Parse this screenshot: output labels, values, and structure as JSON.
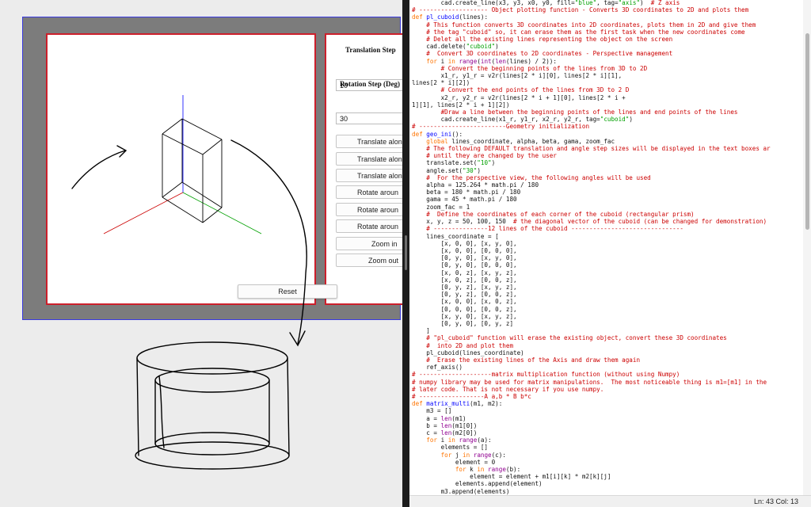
{
  "app": {
    "controls": {
      "translation_step_label": "Translation Step",
      "translation_step_value": "10",
      "rotation_step_label": "Rotation Step (Deg)",
      "rotation_step_value": "30",
      "buttons": [
        "Translate alon",
        "Translate alon",
        "Translate alon",
        "Rotate aroun",
        "Rotate aroun",
        "Rotate aroun",
        "Zoom in",
        "Zoom out"
      ]
    },
    "reset_label": "Reset"
  },
  "colors": {
    "axis_x": "#cc0000",
    "axis_y": "#00a000",
    "axis_z": "#0000ff",
    "frame_border": "#cc1f2b",
    "window_border": "#3a3adf"
  },
  "editor": {
    "status": "Ln: 43  Col: 13",
    "lines": [
      [
        [
          "n",
          "        cad.create_line(x3, y3, x0, y0, fill="
        ],
        [
          "st",
          "\"blue\""
        ],
        [
          "n",
          ", tag="
        ],
        [
          "st",
          "\"axis\""
        ],
        [
          "n",
          ")  "
        ],
        [
          "cm",
          "# Z axis"
        ]
      ],
      [
        [
          "cm",
          "# ------------------- Object plotting function - Converts 3D coordinates to 2D and plots them"
        ]
      ],
      [
        [
          "kw",
          "def "
        ],
        [
          "df",
          "pl_cuboid"
        ],
        [
          "n",
          "(lines):"
        ]
      ],
      [
        [
          "cm",
          "    # This function converts 3D coordinates into 2D coordinates, plots them in 2D and give them"
        ]
      ],
      [
        [
          "cm",
          "    # the tag \"cuboid\" so, it can erase them as the first task when the new coordinates come"
        ]
      ],
      [
        [
          "cm",
          "    # Delet all the existing lines representing the object on the screen"
        ]
      ],
      [
        [
          "n",
          "    cad.delete("
        ],
        [
          "st",
          "\"cuboid\""
        ],
        [
          "n",
          ")"
        ]
      ],
      [
        [
          "cm",
          "    #  Convert 3D coordinates to 2D coordinates - Perspective management"
        ]
      ],
      [
        [
          "kw",
          "    for "
        ],
        [
          "n",
          "i "
        ],
        [
          "kw",
          "in "
        ],
        [
          "bi",
          "range"
        ],
        [
          "n",
          "("
        ],
        [
          "bi",
          "int"
        ],
        [
          "n",
          "("
        ],
        [
          "bi",
          "len"
        ],
        [
          "n",
          "(lines) / 2)):"
        ]
      ],
      [
        [
          "cm",
          "        # Convert the beginning points of the lines from 3D to 2D"
        ]
      ],
      [
        [
          "n",
          "        x1_r, y1_r = v2r(lines[2 * i][0], lines[2 * i][1],"
        ]
      ],
      [
        [
          "n",
          "lines[2 * i][2])"
        ]
      ],
      [
        [
          "cm",
          "        # Convert the end points of the lines from 3D to 2 D"
        ]
      ],
      [
        [
          "n",
          "        x2_r, y2_r = v2r(lines[2 * i + 1][0], lines[2 * i +"
        ]
      ],
      [
        [
          "n",
          "1][1], lines[2 * i + 1][2])"
        ]
      ],
      [
        [
          "cm",
          "        #Draw a line between the beginning points of the lines and end points of the lines"
        ]
      ],
      [
        [
          "n",
          "        cad.create_line(x1_r, y1_r, x2_r, y2_r, tag="
        ],
        [
          "st",
          "\"cuboid\""
        ],
        [
          "n",
          ")"
        ]
      ],
      [
        [
          "cm",
          "# ------------------------Geometry initialization"
        ]
      ],
      [
        [
          "kw",
          "def "
        ],
        [
          "df",
          "geo_ini"
        ],
        [
          "n",
          "():"
        ]
      ],
      [
        [
          "kw",
          "    global "
        ],
        [
          "n",
          "lines_coordinate, alpha, beta, gama, zoom_fac"
        ]
      ],
      [
        [
          "cm",
          "    # The following DEFAULT translation and angle step sizes will be displayed in the text boxes ar"
        ]
      ],
      [
        [
          "cm",
          "    # until they are changed by the user"
        ]
      ],
      [
        [
          "n",
          "    translate.set("
        ],
        [
          "st",
          "\"10\""
        ],
        [
          "n",
          ")"
        ]
      ],
      [
        [
          "n",
          "    angle.set("
        ],
        [
          "st",
          "\"30\""
        ],
        [
          "n",
          ")"
        ]
      ],
      [
        [
          "cm",
          "    #  For the perspective view, the following angles will be used"
        ]
      ],
      [
        [
          "n",
          "    alpha = 125.264 * math.pi / 180"
        ]
      ],
      [
        [
          "n",
          "    beta = 180 * math.pi / 180"
        ]
      ],
      [
        [
          "n",
          "    gama = 45 * math.pi / 180"
        ]
      ],
      [
        [
          "n",
          "    zoom_fac = 1"
        ]
      ],
      [
        [
          "cm",
          "    #  Define the coordinates of each corner of the cuboid (rectangular prism)"
        ]
      ],
      [
        [
          "n",
          "    x, y, z = 50, 100, 150  "
        ],
        [
          "cm",
          "# the diagonal vector of the cuboid (can be changed for demonstration)"
        ]
      ],
      [
        [
          "cm",
          "    # ---------------12 lines of the cuboid -------------------------------"
        ]
      ],
      [
        [
          "n",
          "    lines_coordinate = ["
        ]
      ],
      [
        [
          "n",
          "        [x, 0, 0], [x, y, 0],"
        ]
      ],
      [
        [
          "n",
          "        [x, 0, 0], [0, 0, 0],"
        ]
      ],
      [
        [
          "n",
          "        [0, y, 0], [x, y, 0],"
        ]
      ],
      [
        [
          "n",
          "        [0, y, 0], [0, 0, 0],"
        ]
      ],
      [
        [
          "n",
          "        [x, 0, z], [x, y, z],"
        ]
      ],
      [
        [
          "n",
          "        [x, 0, z], [0, 0, z],"
        ]
      ],
      [
        [
          "n",
          "        [0, y, z], [x, y, z],"
        ]
      ],
      [
        [
          "n",
          "        [0, y, z], [0, 0, z],"
        ]
      ],
      [
        [
          "n",
          "        [x, 0, 0], [x, 0, z],"
        ]
      ],
      [
        [
          "n",
          "        [0, 0, 0], [0, 0, z],"
        ]
      ],
      [
        [
          "n",
          "        [x, y, 0], [x, y, z],"
        ]
      ],
      [
        [
          "n",
          "        [0, y, 0], [0, y, z]"
        ]
      ],
      [
        [
          "n",
          "    ]"
        ]
      ],
      [
        [
          "cm",
          "    # \"pl_cuboid\" function will erase the existing object, convert these 3D coordinates"
        ]
      ],
      [
        [
          "cm",
          "    #  into 2D and plot them"
        ]
      ],
      [
        [
          "n",
          "    pl_cuboid(lines_coordinate)"
        ]
      ],
      [
        [
          "cm",
          "    #  Erase the existing lines of the Axis and draw them again"
        ]
      ],
      [
        [
          "n",
          "    ref_axis()"
        ]
      ],
      [
        [
          "cm",
          "# --------------------matrix multiplication function (without using Numpy)"
        ]
      ],
      [
        [
          "cm",
          "# numpy library may be used for matrix manipulations.  The most noticeable thing is m1=[m1] in the"
        ]
      ],
      [
        [
          "cm",
          "# later code. That is not necessary if you use numpy."
        ]
      ],
      [
        [
          "cm",
          "# ------------------A a,b * B b*c"
        ]
      ],
      [
        [
          "kw",
          "def "
        ],
        [
          "df",
          "matrix_multi"
        ],
        [
          "n",
          "(m1, m2):"
        ]
      ],
      [
        [
          "n",
          "    m3 = []"
        ]
      ],
      [
        [
          "n",
          "    a = "
        ],
        [
          "bi",
          "len"
        ],
        [
          "n",
          "(m1)"
        ]
      ],
      [
        [
          "n",
          "    b = "
        ],
        [
          "bi",
          "len"
        ],
        [
          "n",
          "(m1[0])"
        ]
      ],
      [
        [
          "n",
          "    c = "
        ],
        [
          "bi",
          "len"
        ],
        [
          "n",
          "(m2[0])"
        ]
      ],
      [
        [
          "kw",
          "    for "
        ],
        [
          "n",
          "i "
        ],
        [
          "kw",
          "in "
        ],
        [
          "bi",
          "range"
        ],
        [
          "n",
          "(a):"
        ]
      ],
      [
        [
          "n",
          "        elements = []"
        ]
      ],
      [
        [
          "kw",
          "        for "
        ],
        [
          "n",
          "j "
        ],
        [
          "kw",
          "in "
        ],
        [
          "bi",
          "range"
        ],
        [
          "n",
          "(c):"
        ]
      ],
      [
        [
          "n",
          "            element = 0"
        ]
      ],
      [
        [
          "kw",
          "            for "
        ],
        [
          "n",
          "k "
        ],
        [
          "kw",
          "in "
        ],
        [
          "bi",
          "range"
        ],
        [
          "n",
          "(b):"
        ]
      ],
      [
        [
          "n",
          "                element = element + m1[i][k] * m2[k][j]"
        ]
      ],
      [
        [
          "n",
          "            elements.append(element)"
        ]
      ],
      [
        [
          "n",
          "        m3.append(elements)"
        ]
      ]
    ]
  }
}
